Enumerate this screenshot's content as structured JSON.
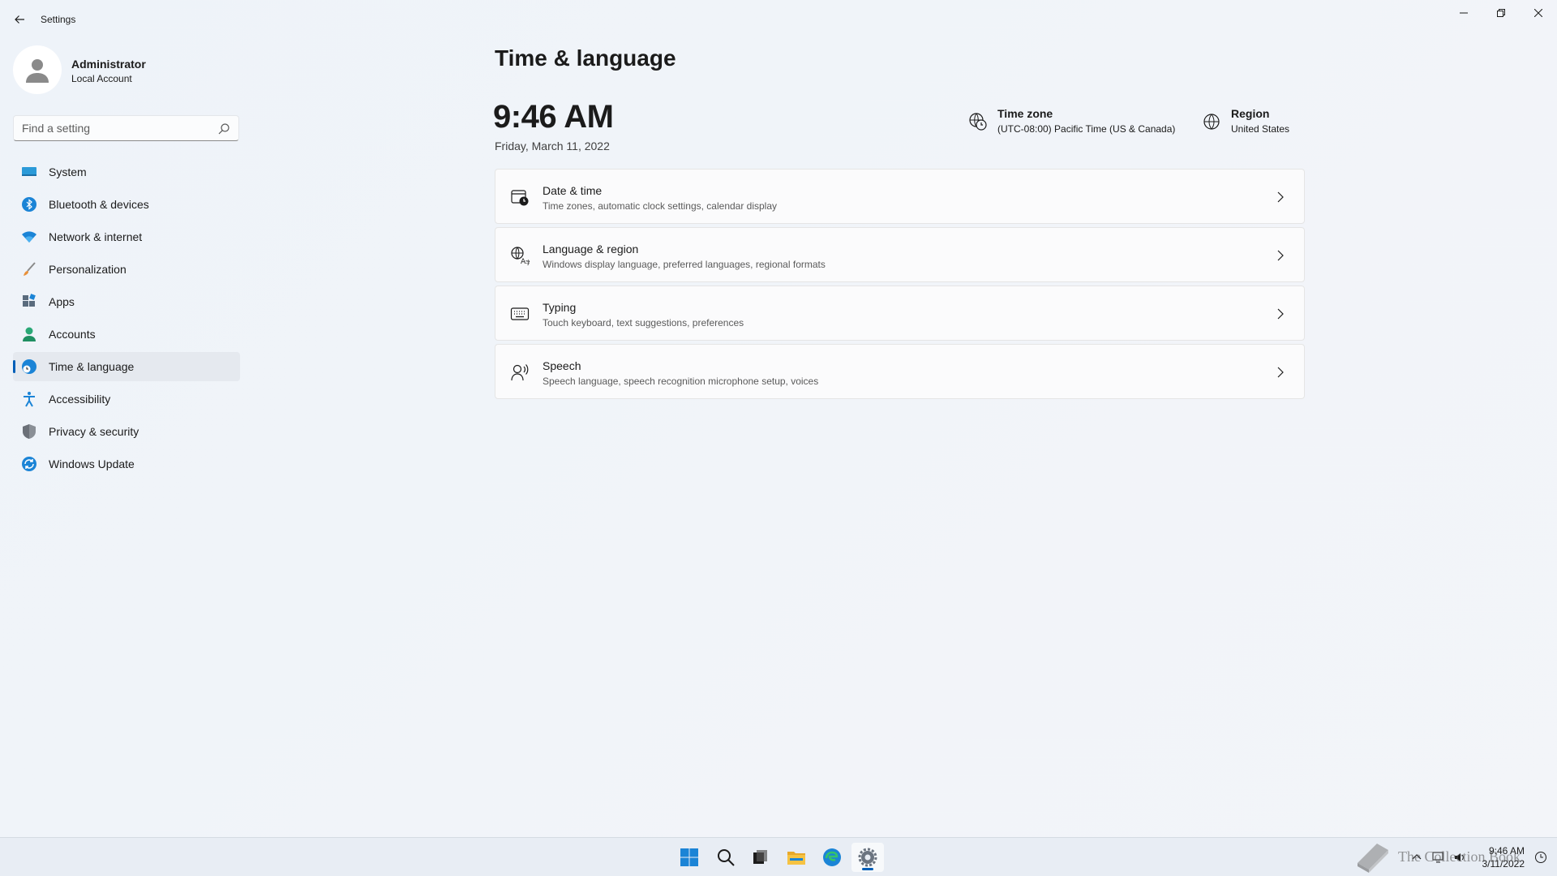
{
  "window": {
    "title": "Settings"
  },
  "user": {
    "name": "Administrator",
    "account_type": "Local Account"
  },
  "search": {
    "placeholder": "Find a setting"
  },
  "sidebar": {
    "items": [
      {
        "label": "System",
        "icon": "monitor-icon"
      },
      {
        "label": "Bluetooth & devices",
        "icon": "bluetooth-icon"
      },
      {
        "label": "Network & internet",
        "icon": "wifi-icon"
      },
      {
        "label": "Personalization",
        "icon": "brush-icon"
      },
      {
        "label": "Apps",
        "icon": "apps-icon"
      },
      {
        "label": "Accounts",
        "icon": "person-icon"
      },
      {
        "label": "Time & language",
        "icon": "globe-clock-icon",
        "active": true
      },
      {
        "label": "Accessibility",
        "icon": "accessibility-icon"
      },
      {
        "label": "Privacy & security",
        "icon": "shield-icon"
      },
      {
        "label": "Windows Update",
        "icon": "update-icon"
      }
    ]
  },
  "main": {
    "title": "Time & language",
    "time": "9:46 AM",
    "date": "Friday, March 11, 2022",
    "time_zone": {
      "label": "Time zone",
      "value": "(UTC-08:00) Pacific Time (US & Canada)"
    },
    "region": {
      "label": "Region",
      "value": "United States"
    },
    "cards": [
      {
        "title": "Date & time",
        "subtitle": "Time zones, automatic clock settings, calendar display",
        "icon": "calendar-clock-icon"
      },
      {
        "title": "Language & region",
        "subtitle": "Windows display language, preferred languages, regional formats",
        "icon": "language-icon"
      },
      {
        "title": "Typing",
        "subtitle": "Touch keyboard, text suggestions, preferences",
        "icon": "keyboard-icon"
      },
      {
        "title": "Speech",
        "subtitle": "Speech language, speech recognition microphone setup, voices",
        "icon": "speech-icon"
      }
    ]
  },
  "taskbar": {
    "apps": [
      "start-icon",
      "search-icon",
      "task-view-icon",
      "file-explorer-icon",
      "edge-icon",
      "settings-icon"
    ],
    "clock_time": "9:46 AM",
    "clock_date": "3/11/2022",
    "watermark": "The Collection Book"
  },
  "colors": {
    "accent": "#005fb8",
    "background": "#eef3f9"
  }
}
